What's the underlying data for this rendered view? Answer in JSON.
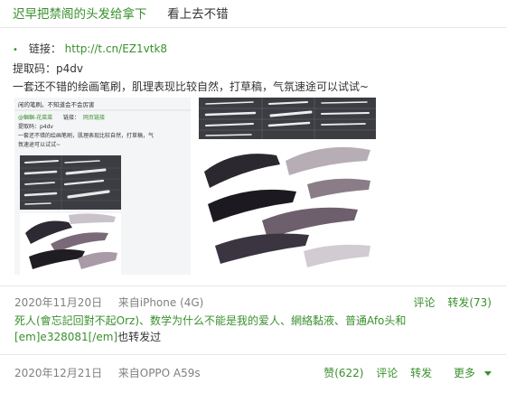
{
  "post": {
    "title": "迟早把禁阁的头发给拿下",
    "title_note": "看上去不错",
    "link_label": "链接：",
    "link_url": "http://t.cn/EZ1vtk8",
    "code_line": "提取码：p4dv",
    "description": "一套还不错的绘画笔刷，肌理表现比较自然，打草稿，气氛速途可以试试~"
  },
  "thumb_left": {
    "header": "闲的笔刷。不知道会不会厉害",
    "line1_user": "@蝈蝈-花菜菜",
    "line1_rest": "链接：",
    "line1_link": "网页链接",
    "line2": "提取码：p4dv",
    "line3": "一套还不错的绘画笔刷，肌理表现比较自然，打草稿，气",
    "line4": "氛速途可以试试~"
  },
  "meta1": {
    "date": "2020年11月20日",
    "source": "来自iPhone (4G)",
    "comment": "评论",
    "repost": "转发(73)"
  },
  "reposters": {
    "names": "死人(會忘記回對不起Orz)、数学为什么不能是我的爱人、網絡黏液、普通Afo头和",
    "emoji_code": "[em]e328081[/em]",
    "suffix": "也转发过"
  },
  "meta2": {
    "date": "2020年12月21日",
    "source": "来自OPPO A59s",
    "like": "赞(622)",
    "comment": "评论",
    "repost": "转发",
    "more": "更多"
  },
  "colors": {
    "link": "#3a8f2e",
    "text": "#333333",
    "meta": "#808080",
    "divider": "#e6e6e6"
  }
}
